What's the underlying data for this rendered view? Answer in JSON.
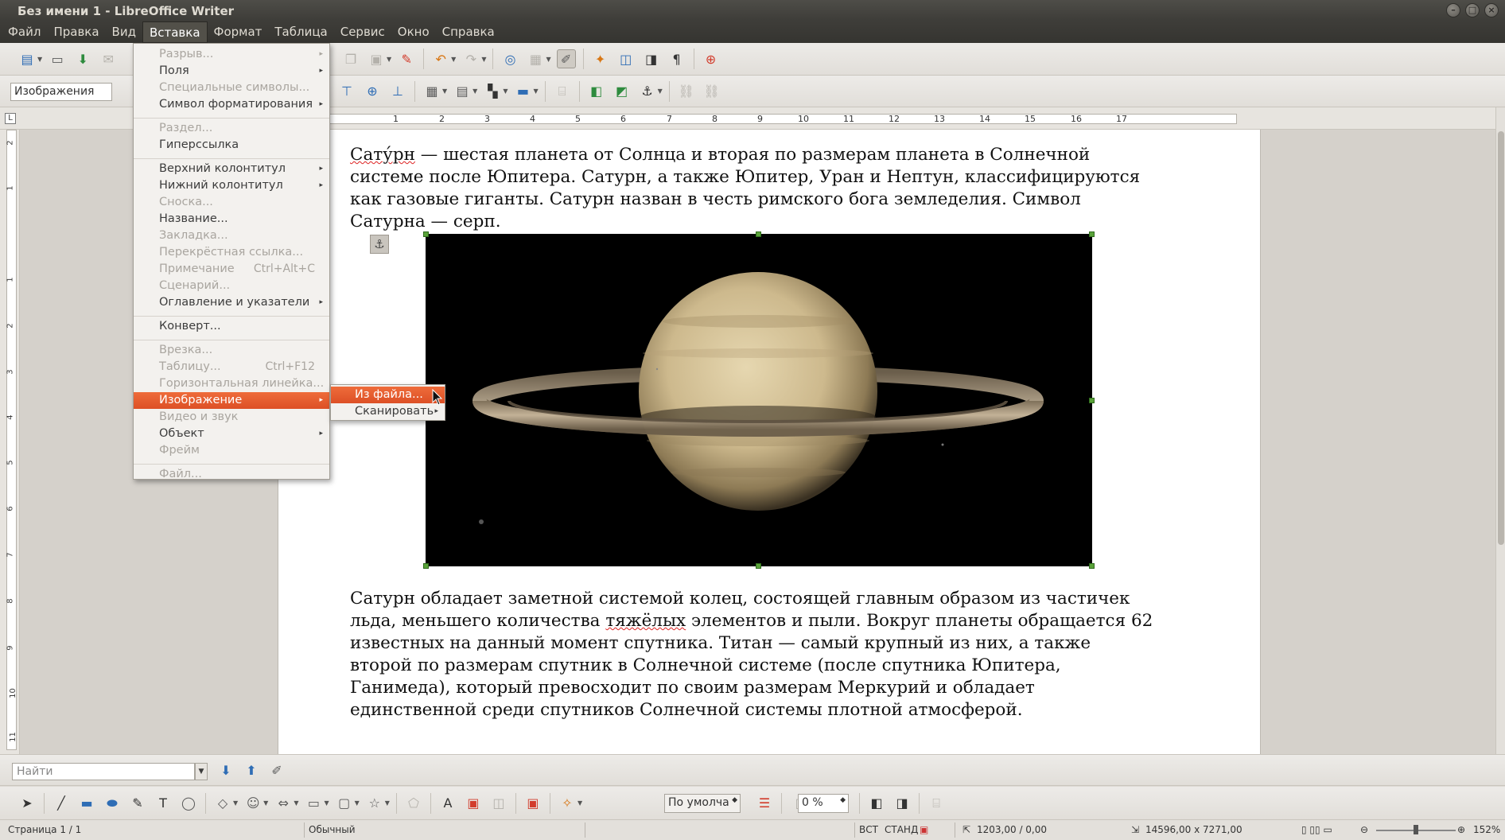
{
  "window": {
    "title": "Без имени 1 - LibreOffice Writer",
    "buttons": [
      "–",
      "□",
      "×"
    ]
  },
  "menubar": {
    "items": [
      "Файл",
      "Правка",
      "Вид",
      "Вставка",
      "Формат",
      "Таблица",
      "Сервис",
      "Окно",
      "Справка"
    ],
    "active": "Вставка"
  },
  "toolbar": {
    "paragraph_style": "Изображения"
  },
  "ruler": {
    "h_ticks": [
      "2",
      "1",
      "1",
      "2",
      "3",
      "4",
      "5",
      "6",
      "7",
      "8",
      "9",
      "10",
      "11",
      "12",
      "13",
      "14",
      "15",
      "16",
      "17"
    ],
    "v_ticks": [
      "2",
      "1",
      "1",
      "2",
      "3",
      "4",
      "5",
      "6",
      "7",
      "8",
      "9",
      "10",
      "11"
    ]
  },
  "insert_menu": {
    "items": [
      {
        "label": "Разрыв...",
        "enabled": false,
        "submenu": true
      },
      {
        "label": "Поля",
        "enabled": true,
        "submenu": true
      },
      {
        "label": "Специальные символы...",
        "enabled": false
      },
      {
        "label": "Символ форматирования",
        "enabled": true,
        "submenu": true
      },
      {
        "label": "Раздел...",
        "enabled": false,
        "sep_before": true
      },
      {
        "label": "Гиперссылка",
        "enabled": true
      },
      {
        "label": "Верхний колонтитул",
        "enabled": true,
        "submenu": true,
        "sep_before": true
      },
      {
        "label": "Нижний колонтитул",
        "enabled": true,
        "submenu": true
      },
      {
        "label": "Сноска...",
        "enabled": false
      },
      {
        "label": "Название...",
        "enabled": true
      },
      {
        "label": "Закладка...",
        "enabled": false
      },
      {
        "label": "Перекрёстная ссылка...",
        "enabled": false
      },
      {
        "label": "Примечание",
        "enabled": false,
        "shortcut": "Ctrl+Alt+C"
      },
      {
        "label": "Сценарий...",
        "enabled": false
      },
      {
        "label": "Оглавление и указатели",
        "enabled": true,
        "submenu": true
      },
      {
        "label": "Конверт...",
        "enabled": true,
        "sep_before": true
      },
      {
        "label": "Врезка...",
        "enabled": false,
        "sep_before": true
      },
      {
        "label": "Таблицу...",
        "enabled": false,
        "shortcut": "Ctrl+F12"
      },
      {
        "label": "Горизонтальная линейка...",
        "enabled": false
      },
      {
        "label": "Изображение",
        "enabled": true,
        "submenu": true,
        "highlighted": true
      },
      {
        "label": "Видео и звук",
        "enabled": false
      },
      {
        "label": "Объект",
        "enabled": true,
        "submenu": true
      },
      {
        "label": "Фрейм",
        "enabled": false
      },
      {
        "label": "Файл...",
        "enabled": false,
        "sep_before": true
      }
    ]
  },
  "image_submenu": {
    "items": [
      {
        "label": "Из файла...",
        "highlighted": true
      },
      {
        "label": "Сканировать",
        "submenu": true
      }
    ]
  },
  "document": {
    "para1": {
      "first_word": "Сату́рн",
      "rest": " — шестая планета от Солнца и вторая по размерам планета в Солнечной системе после Юпитера. Сатурн, а также Юпитер, Уран и Нептун, классифицируются как газовые гиганты. Сатурн назван в честь римского бога земледелия. Символ Сатурна — серп."
    },
    "para2": {
      "part1": "Сатурн обладает заметной системой колец, состоящей главным образом из частичек льда, меньшего количества ",
      "misspelled": "тяжёлых",
      "part2": " элементов и пыли. Вокруг планеты обращается 62 известных на данный момент спутника. Титан — самый крупный из них, а также второй по размерам спутник в Солнечной системе (после спутника Юпитера, Ганимеда), который превосходит по своим размерам Меркурий и обладает единственной среди спутников Солнечной системы плотной атмосферой."
    },
    "image_alt": "Saturn"
  },
  "findbar": {
    "placeholder": "Найти"
  },
  "drawbar": {
    "position_combo": "По умолча",
    "percent": "0 %"
  },
  "statusbar": {
    "page": "Страница 1 / 1",
    "style": "Обычный",
    "insert_mode": "ВСТ",
    "selection_mode": "СТАНД",
    "position": "1203,00 / 0,00",
    "size": "14596,00 x 7271,00",
    "zoom": "152%"
  },
  "colors": {
    "menu_highlight": "#e0592c",
    "titlebar": "#3e3d39",
    "selection_handle": "#5aa33a"
  }
}
